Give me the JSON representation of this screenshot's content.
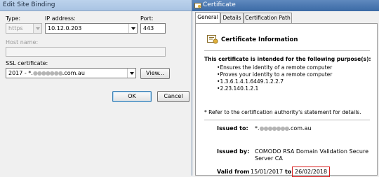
{
  "binding": {
    "title": "Edit Site Binding",
    "type_label": "Type:",
    "type_value": "https",
    "ip_label": "IP address:",
    "ip_value": "10.12.0.203",
    "port_label": "Port:",
    "port_value": "443",
    "host_label": "Host name:",
    "host_value": "",
    "ssl_label": "SSL certificate:",
    "ssl_prefix": "2017 - *.",
    "ssl_redacted": "●●●●●●●",
    "ssl_suffix": ".com.au",
    "view_button": "View...",
    "ok_button": "OK",
    "cancel_button": "Cancel"
  },
  "certificate": {
    "title": "Certificate",
    "tabs": [
      "General",
      "Details",
      "Certification Path"
    ],
    "info_heading": "Certificate Information",
    "purpose_heading": "This certificate is intended for the following purpose(s):",
    "purposes": [
      "Ensures the identity of a remote computer",
      "Proves your identity to a remote computer",
      "1.3.6.1.4.1.6449.1.2.2.7",
      "2.23.140.1.2.1"
    ],
    "refer_note": "* Refer to the certification authority's statement for details.",
    "issued_to_label": "Issued to:",
    "issued_to_prefix": "*.",
    "issued_to_redacted": "●●●●●●●",
    "issued_to_suffix": ".com.au",
    "issued_by_label": "Issued by:",
    "issued_by_value": "COMODO RSA Domain Validation Secure Server CA",
    "valid_from_label": "Valid from",
    "valid_from_value": "15/01/2017",
    "valid_to_label": "to",
    "valid_to_value": "26/02/2018"
  }
}
